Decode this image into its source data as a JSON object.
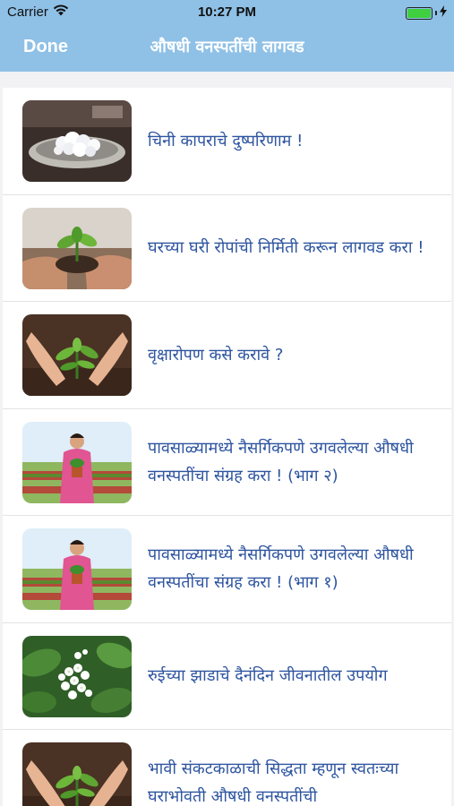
{
  "status_bar": {
    "carrier": "Carrier",
    "time": "10:27 PM",
    "battery_level": 1.0,
    "battery_color": "#3fcf3f"
  },
  "nav": {
    "done_label": "Done",
    "title": "औषधी वनस्पतींची लागवड",
    "background": "#8fc0e6"
  },
  "articles": [
    {
      "title": "चिनी कापराचे दुष्परिणाम !",
      "thumb_icon": "camphor-plate-image"
    },
    {
      "title": "घरच्या घरी रोपांची निर्मिती करून लागवड करा !",
      "thumb_icon": "hands-with-seedling-image"
    },
    {
      "title": "वृक्षारोपण कसे करावे ?",
      "thumb_icon": "hands-planting-image"
    },
    {
      "title": "पावसाळ्यामध्ये नैसर्गिकपणे उगवलेल्या औषधी वनस्पतींचा संग्रह करा ! (भाग २)",
      "thumb_icon": "woman-holding-plant-image"
    },
    {
      "title": "पावसाळ्यामध्ये नैसर्गिकपणे उगवलेल्या औषधी वनस्पतींचा संग्रह करा ! (भाग १)",
      "thumb_icon": "woman-holding-plant-image"
    },
    {
      "title": "रुईच्या झाडाचे दैनंदिन जीवनातील उपयोग",
      "thumb_icon": "white-flowers-image"
    },
    {
      "title": "भावी संकटकाळाची सिद्धता म्हणून स्वतःच्या घराभोवती औषधी वनस्पतींची",
      "thumb_icon": "hands-planting-image"
    }
  ]
}
